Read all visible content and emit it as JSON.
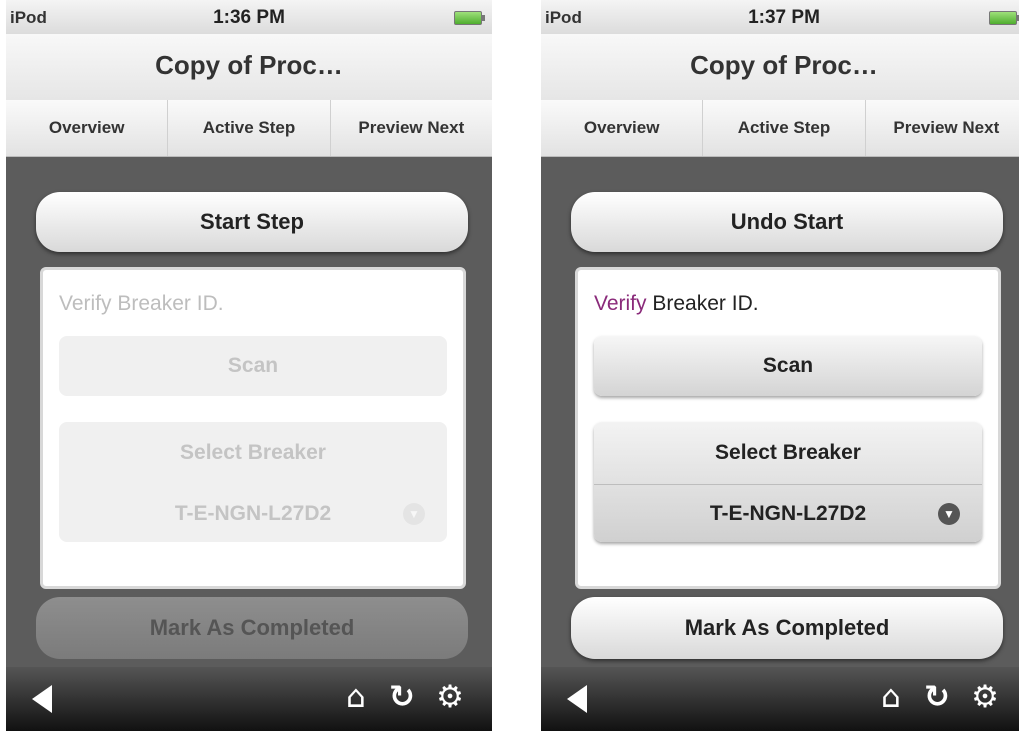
{
  "screens": [
    {
      "status": {
        "carrier": "iPod",
        "time": "1:36 PM"
      },
      "title": "Copy of Proc…",
      "tabs": [
        "Overview",
        "Active Step",
        "Preview Next"
      ],
      "top_button": "Start Step",
      "card": {
        "prompt_verb": "Verify",
        "prompt_rest": " Breaker ID.",
        "scan_button": "Scan",
        "select_label": "Select Breaker",
        "select_value": "T-E-NGN-L27D2",
        "enabled": false
      },
      "bottom_button": "Mark As Completed",
      "bottom_bar_icons": [
        "back-icon",
        "home-icon",
        "refresh-icon",
        "settings-icon"
      ]
    },
    {
      "status": {
        "carrier": "iPod",
        "time": "1:37 PM"
      },
      "title": "Copy of Proc…",
      "tabs": [
        "Overview",
        "Active Step",
        "Preview Next"
      ],
      "top_button": "Undo Start",
      "card": {
        "prompt_verb": "Verify",
        "prompt_rest": " Breaker ID.",
        "scan_button": "Scan",
        "select_label": "Select Breaker",
        "select_value": "T-E-NGN-L27D2",
        "enabled": true
      },
      "bottom_button": "Mark As Completed",
      "bottom_bar_icons": [
        "back-icon",
        "home-icon",
        "refresh-icon",
        "settings-icon"
      ]
    }
  ],
  "colors": {
    "content_bg": "#5c5c5c",
    "verb_highlight": "#8a2a7a",
    "battery_green": "#4fae2f"
  }
}
